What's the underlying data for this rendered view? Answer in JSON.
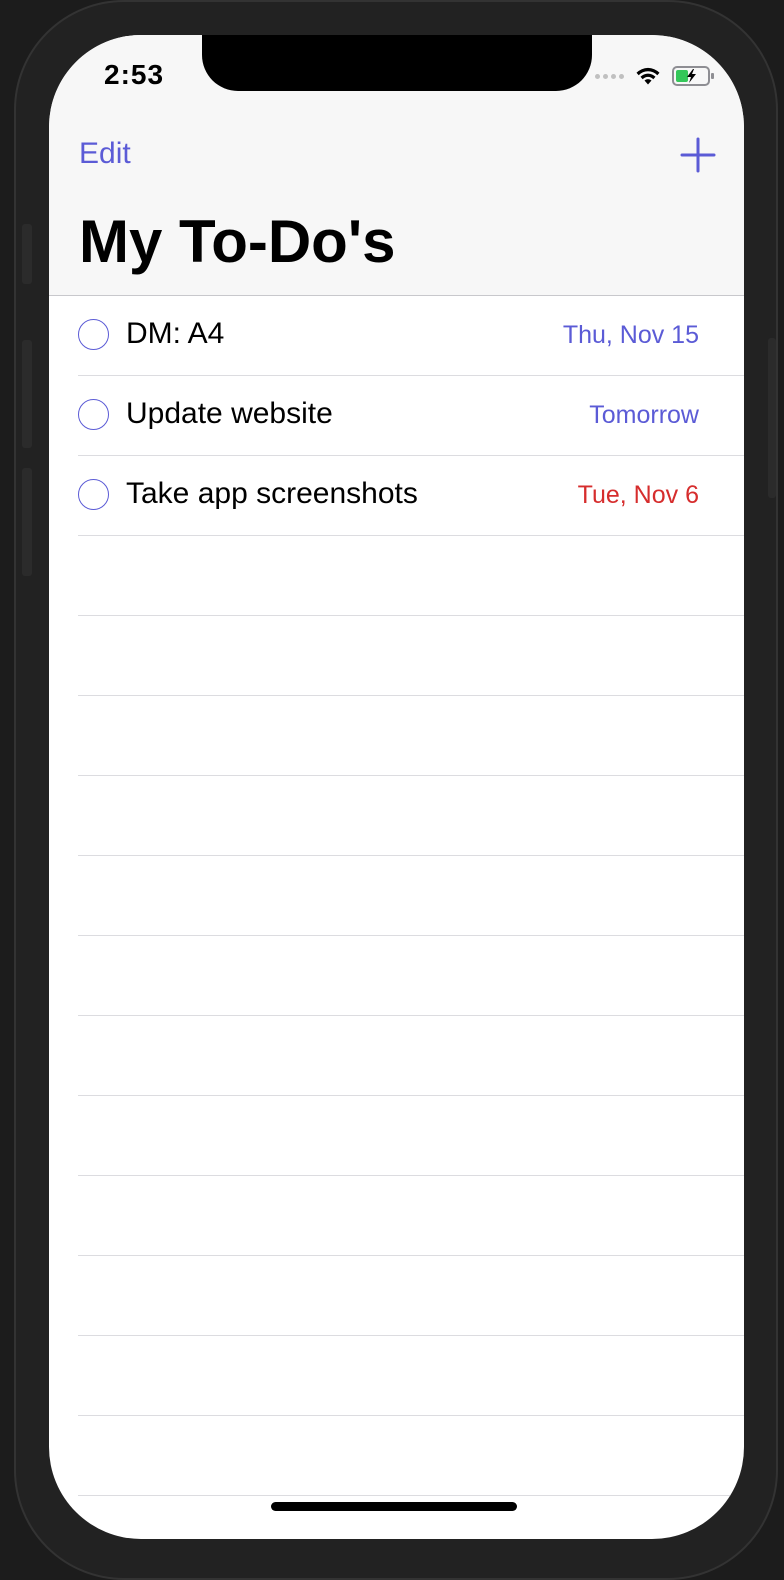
{
  "status": {
    "time": "2:53",
    "wifi_icon": "wifi-icon",
    "battery_icon": "battery-charging-icon"
  },
  "nav": {
    "edit_label": "Edit",
    "add_icon": "plus-icon",
    "title": "My To-Do's"
  },
  "colors": {
    "accent": "#5b5bd6",
    "overdue": "#d62d2d"
  },
  "todos": [
    {
      "title": "DM: A4",
      "due": "Thu, Nov 15",
      "due_color": "#5b5bd6"
    },
    {
      "title": "Update website",
      "due": "Tomorrow",
      "due_color": "#5b5bd6"
    },
    {
      "title": "Take app screenshots",
      "due": "Tue, Nov 6",
      "due_color": "#d62d2d"
    }
  ]
}
